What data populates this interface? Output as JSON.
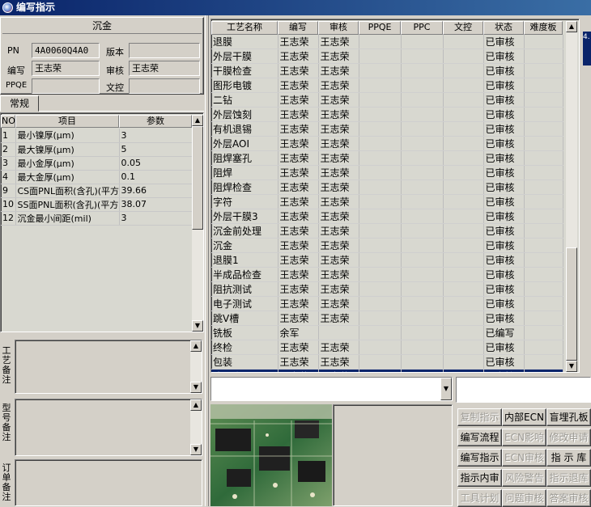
{
  "window": {
    "title": "编写指示"
  },
  "header": {
    "section_title": "沉金",
    "pn_label": "PN",
    "pn_value": "4A0060Q4A0",
    "version_label": "版本",
    "version_value": "",
    "writer_label": "编写",
    "writer_value": "王志荣",
    "reviewer_label": "审核",
    "reviewer_value": "王志荣",
    "ppqe_label": "PPQE",
    "ppqe_value": "",
    "doc_control_label": "文控",
    "doc_control_value": ""
  },
  "params": {
    "tab_label": "常规",
    "columns": [
      "NO",
      "项目",
      "参数"
    ],
    "rows": [
      {
        "no": "1",
        "item": "最小镍厚(μm)",
        "value": "3"
      },
      {
        "no": "2",
        "item": "最大镍厚(μm)",
        "value": "5"
      },
      {
        "no": "3",
        "item": "最小金厚(μm)",
        "value": "0.05"
      },
      {
        "no": "4",
        "item": "最大金厚(μm)",
        "value": "0.1"
      },
      {
        "no": "9",
        "item": "CS面PNL面积(含孔)(平方",
        "value": "39.66"
      },
      {
        "no": "10",
        "item": "SS面PNL面积(含孔)(平方",
        "value": "38.07"
      },
      {
        "no": "12",
        "item": "沉金最小间距(mil)",
        "value": "3"
      }
    ]
  },
  "notes": {
    "process_label": "工艺备注",
    "model_label": "型号备注",
    "order_label": "订单备注"
  },
  "process": {
    "columns": [
      "工艺名称",
      "编写",
      "审核",
      "PPQE",
      "PPC",
      "文控",
      "状态",
      "难度板"
    ],
    "rows": [
      {
        "name": "退膜",
        "writer": "王志荣",
        "reviewer": "王志荣",
        "status": "已审核"
      },
      {
        "name": "外层干膜",
        "writer": "王志荣",
        "reviewer": "王志荣",
        "status": "已审核"
      },
      {
        "name": "干膜检查",
        "writer": "王志荣",
        "reviewer": "王志荣",
        "status": "已审核"
      },
      {
        "name": "图形电镀",
        "writer": "王志荣",
        "reviewer": "王志荣",
        "status": "已审核"
      },
      {
        "name": "二钻",
        "writer": "王志荣",
        "reviewer": "王志荣",
        "status": "已审核"
      },
      {
        "name": "外层蚀刻",
        "writer": "王志荣",
        "reviewer": "王志荣",
        "status": "已审核"
      },
      {
        "name": "有机退锡",
        "writer": "王志荣",
        "reviewer": "王志荣",
        "status": "已审核"
      },
      {
        "name": "外层AOI",
        "writer": "王志荣",
        "reviewer": "王志荣",
        "status": "已审核"
      },
      {
        "name": "阻焊塞孔",
        "writer": "王志荣",
        "reviewer": "王志荣",
        "status": "已审核"
      },
      {
        "name": "阻焊",
        "writer": "王志荣",
        "reviewer": "王志荣",
        "status": "已审核"
      },
      {
        "name": "阻焊检查",
        "writer": "王志荣",
        "reviewer": "王志荣",
        "status": "已审核"
      },
      {
        "name": "字符",
        "writer": "王志荣",
        "reviewer": "王志荣",
        "status": "已审核"
      },
      {
        "name": "外层干膜3",
        "writer": "王志荣",
        "reviewer": "王志荣",
        "status": "已审核"
      },
      {
        "name": "沉金前处理",
        "writer": "王志荣",
        "reviewer": "王志荣",
        "status": "已审核"
      },
      {
        "name": "沉金",
        "writer": "王志荣",
        "reviewer": "王志荣",
        "status": "已审核"
      },
      {
        "name": "退膜1",
        "writer": "王志荣",
        "reviewer": "王志荣",
        "status": "已审核"
      },
      {
        "name": "半成品检查",
        "writer": "王志荣",
        "reviewer": "王志荣",
        "status": "已审核"
      },
      {
        "name": "阻抗测试",
        "writer": "王志荣",
        "reviewer": "王志荣",
        "status": "已审核"
      },
      {
        "name": "电子测试",
        "writer": "王志荣",
        "reviewer": "王志荣",
        "status": "已审核"
      },
      {
        "name": "跳V槽",
        "writer": "王志荣",
        "reviewer": "王志荣",
        "status": "已审核"
      },
      {
        "name": "铣板",
        "writer": "余军",
        "reviewer": "",
        "status": "已编写"
      },
      {
        "name": "终检",
        "writer": "王志荣",
        "reviewer": "王志荣",
        "status": "已审核"
      },
      {
        "name": "包装",
        "writer": "王志荣",
        "reviewer": "王志荣",
        "status": "已审核"
      },
      {
        "name": "成品仓",
        "writer": "王志荣",
        "reviewer": "王志荣",
        "status": "已审核"
      }
    ],
    "selected_index": 23
  },
  "side_strip": {
    "text": "4."
  },
  "buttons": [
    {
      "label": "复制指示",
      "enabled": false
    },
    {
      "label": "内部ECN",
      "enabled": true
    },
    {
      "label": "盲埋孔板",
      "enabled": true
    },
    {
      "label": "编写流程",
      "enabled": true
    },
    {
      "label": "ECN影响",
      "enabled": false
    },
    {
      "label": "修改申请",
      "enabled": false
    },
    {
      "label": "编写指示",
      "enabled": true
    },
    {
      "label": "ECN审核",
      "enabled": false
    },
    {
      "label": "指 示 库",
      "enabled": true
    },
    {
      "label": "指示内审",
      "enabled": true
    },
    {
      "label": "风险警告",
      "enabled": false
    },
    {
      "label": "指示退库",
      "enabled": false
    },
    {
      "label": "工具计划",
      "enabled": false
    },
    {
      "label": "问题审核",
      "enabled": false
    },
    {
      "label": "答案审核",
      "enabled": false
    }
  ],
  "colors": {
    "title_bar": "#0a246a",
    "selection": "#0a246a",
    "face": "#d4d0c8",
    "grid_bg": "#d8d8d0"
  }
}
